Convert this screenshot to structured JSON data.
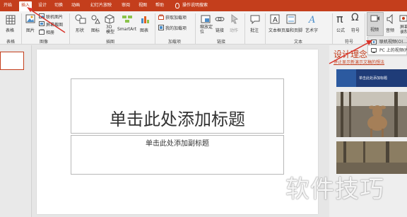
{
  "tabs": [
    {
      "label": "开始"
    },
    {
      "label": "插入"
    },
    {
      "label": "设计"
    },
    {
      "label": "切换"
    },
    {
      "label": "动画"
    },
    {
      "label": "幻灯片放映"
    },
    {
      "label": "审阅"
    },
    {
      "label": "视图"
    },
    {
      "label": "帮助"
    }
  ],
  "tell_me": "操作说明搜索",
  "ribbon": {
    "table": "表格",
    "picture": "图片",
    "online_picture": "联机图片",
    "screenshot": "屏幕截图",
    "album": "相册",
    "shapes": "形状",
    "icons": "图标",
    "model3d": "3D\n模型",
    "smartart": "SmartArt",
    "chart": "图表",
    "get_addins": "获取加载项",
    "my_addins": "我的加载项",
    "zoom": "缩放定\n位",
    "link": "链接",
    "action": "动作",
    "comment": "批注",
    "textbox": "文本框",
    "header_footer": "页眉和页脚",
    "wordart": "艺术字",
    "equation": "公式",
    "symbol": "符号",
    "video": "视频",
    "audio": "音频",
    "screen_record": "屏幕\n录制",
    "groups": {
      "tables": "表格",
      "images": "图像",
      "illustrations": "插图",
      "addins": "加载项",
      "links": "链接",
      "text": "文本",
      "symbols": "符号"
    }
  },
  "slide": {
    "title_placeholder": "单击此处添加标题",
    "subtitle_placeholder": "单击此处添加副标题"
  },
  "design_panel": {
    "title": "设计理念",
    "link": "停止显示新演示文稿的想法",
    "card1_caption": "单击此处添加标题"
  },
  "video_menu": {
    "online_video": "联机视频(O)...",
    "pc_video": "PC 上的视频(P)..."
  },
  "watermark": "软件技巧",
  "colors": {
    "accent": "#c43e1c",
    "arrow": "#d9342b"
  }
}
